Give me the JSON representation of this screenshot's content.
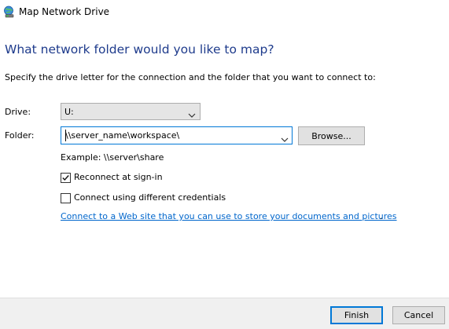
{
  "window": {
    "title": "Map Network Drive"
  },
  "heading": "What network folder would you like to map?",
  "instruction": "Specify the drive letter for the connection and the folder that you want to connect to:",
  "drive": {
    "label": "Drive:",
    "value": "U:"
  },
  "folder": {
    "label": "Folder:",
    "value": "\\\\server_name\\workspace\\",
    "browse_label": "Browse..."
  },
  "example": "Example: \\\\server\\share",
  "reconnect": {
    "label": "Reconnect at sign-in",
    "checked": true
  },
  "credentials": {
    "label": "Connect using different credentials",
    "checked": false
  },
  "web_link": "Connect to a Web site that you can use to store your documents and pictures",
  "web_link_suffix": ".",
  "buttons": {
    "finish": "Finish",
    "cancel": "Cancel"
  },
  "colors": {
    "heading": "#1e3b8c",
    "link": "#0066cc",
    "focus_border": "#0078d7"
  },
  "icons": {
    "title": "network-drive-icon",
    "dropdown": "chevron-down-icon",
    "check": "checkmark-icon"
  }
}
